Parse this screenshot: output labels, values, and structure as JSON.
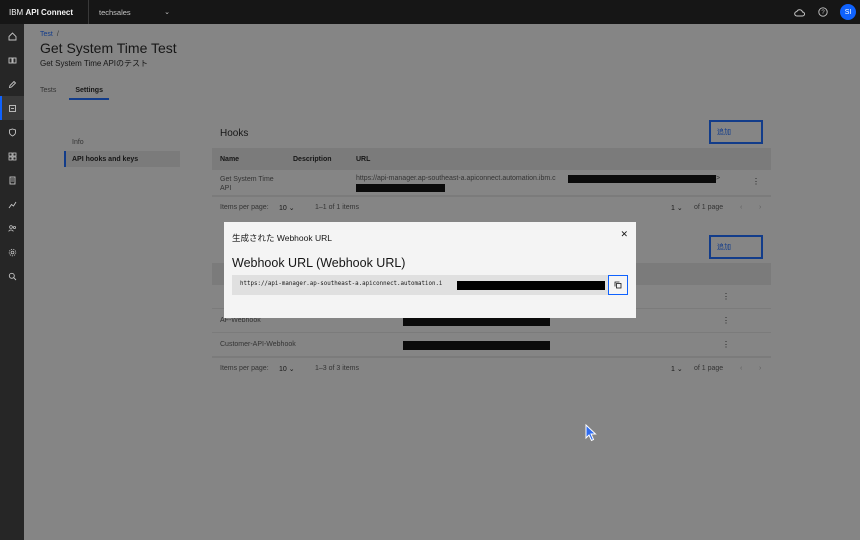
{
  "topbar": {
    "brand_prefix": "IBM",
    "brand_name": "API Connect",
    "catalog": "techsales",
    "avatar_initials": "SI"
  },
  "breadcrumb": {
    "link": "Test",
    "separator": "/"
  },
  "page": {
    "title": "Get System Time Test",
    "subtitle": "Get System Time APIのテスト"
  },
  "tabs": [
    {
      "label": "Tests"
    },
    {
      "label": "Settings"
    }
  ],
  "leftnav": [
    {
      "label": "Info"
    },
    {
      "label": "API hooks and keys"
    }
  ],
  "hooks": {
    "title": "Hooks",
    "add_label": "追加",
    "columns": [
      "Name",
      "Description",
      "URL"
    ],
    "rows": [
      {
        "name": "Get System Time API",
        "description": "",
        "url": "https://api-manager.ap-southeast-a.apiconnect.automation.ibm.c"
      }
    ],
    "pager": {
      "items_per_page_label": "Items per page:",
      "per_page": "10",
      "range": "1–1 of 1 items",
      "page": "1",
      "of_pages": "of 1 page"
    }
  },
  "webhooks": {
    "add_label": "追加",
    "rows": [
      {
        "name": "AF-Webhook"
      },
      {
        "name": "Customer-API-Webhook"
      }
    ],
    "pager": {
      "items_per_page_label": "Items per page:",
      "per_page": "10",
      "range": "1–3 of 3 items",
      "page": "1",
      "of_pages": "of 1 page"
    }
  },
  "modal": {
    "label": "生成された Webhook URL",
    "heading": "Webhook URL (Webhook URL)",
    "url": "https://api-manager.ap-southeast-a.apiconnect.automation.i"
  },
  "colors": {
    "accent": "#0f62fe",
    "shell": "#161616",
    "sidenav": "#262626"
  }
}
